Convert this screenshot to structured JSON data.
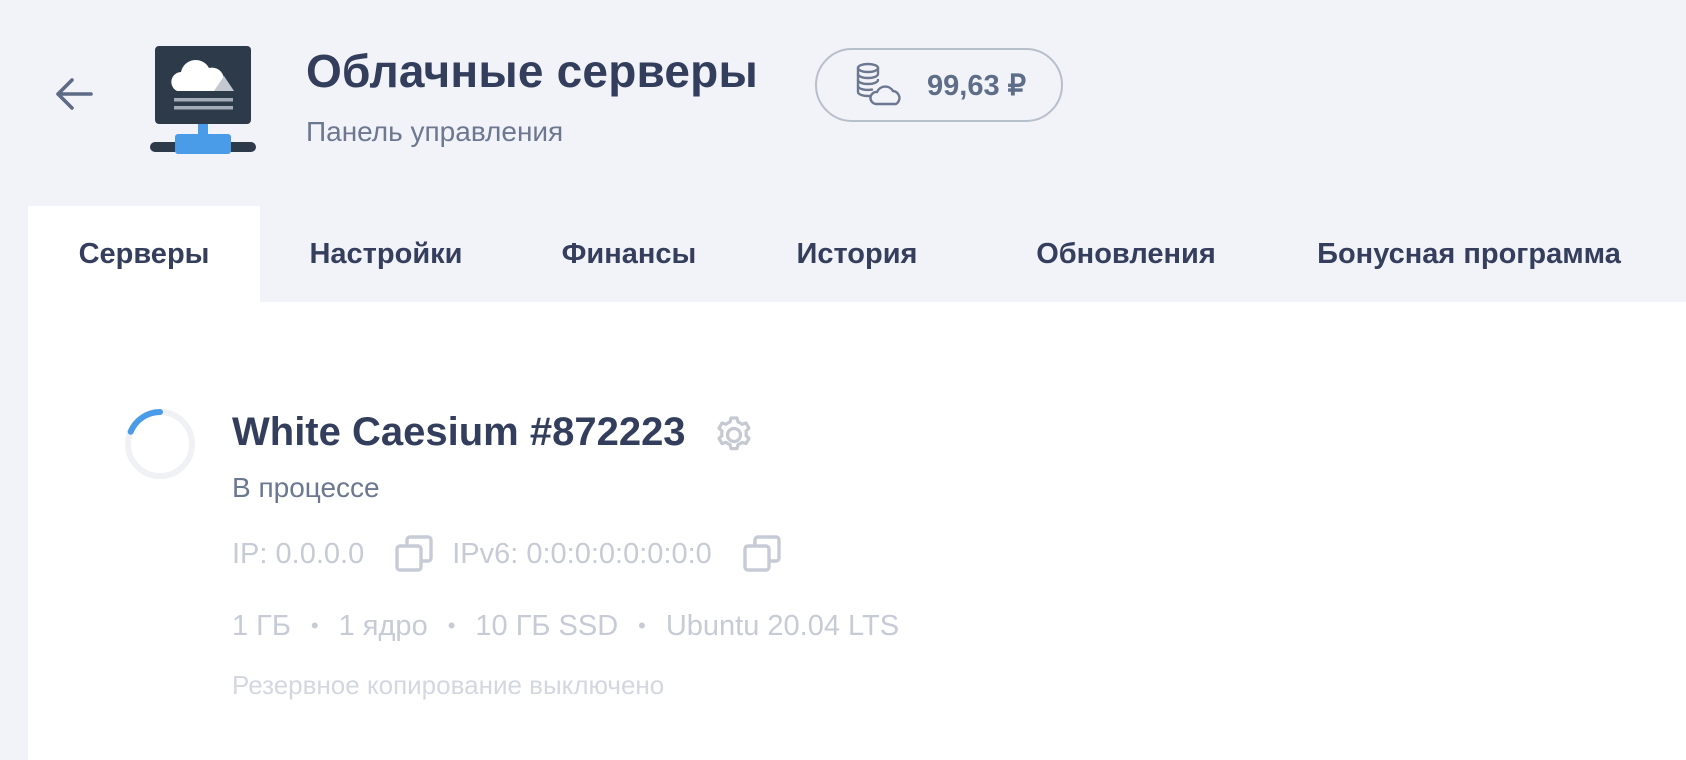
{
  "header": {
    "title": "Облачные серверы",
    "subtitle": "Панель управления",
    "back_icon": "arrow-left-icon",
    "logo_icon": "cloud-server-icon"
  },
  "balance": {
    "icon": "coins-cloud-icon",
    "value": "99,63 ₽"
  },
  "tabs": [
    {
      "label": "Серверы",
      "active": true
    },
    {
      "label": "Настройки",
      "active": false
    },
    {
      "label": "Финансы",
      "active": false
    },
    {
      "label": "История",
      "active": false
    },
    {
      "label": "Обновления",
      "active": false
    },
    {
      "label": "Бонусная программа",
      "active": false
    }
  ],
  "server": {
    "name": "White Caesium #872223",
    "status": "В процессе",
    "ip": "IP: 0.0.0.0",
    "ipv6": "IPv6: 0:0:0:0:0:0:0:0",
    "specs": [
      "1 ГБ",
      "1 ядро",
      "10 ГБ SSD",
      "Ubuntu 20.04 LTS"
    ],
    "backup": "Резервное копирование выключено"
  },
  "colors": {
    "background": "#f2f3f8",
    "panel": "#ffffff",
    "title": "#333e5c",
    "muted_text": "#c6cbd5",
    "accent_blue": "#4a9be8",
    "logo_dark": "#2d3a49"
  }
}
